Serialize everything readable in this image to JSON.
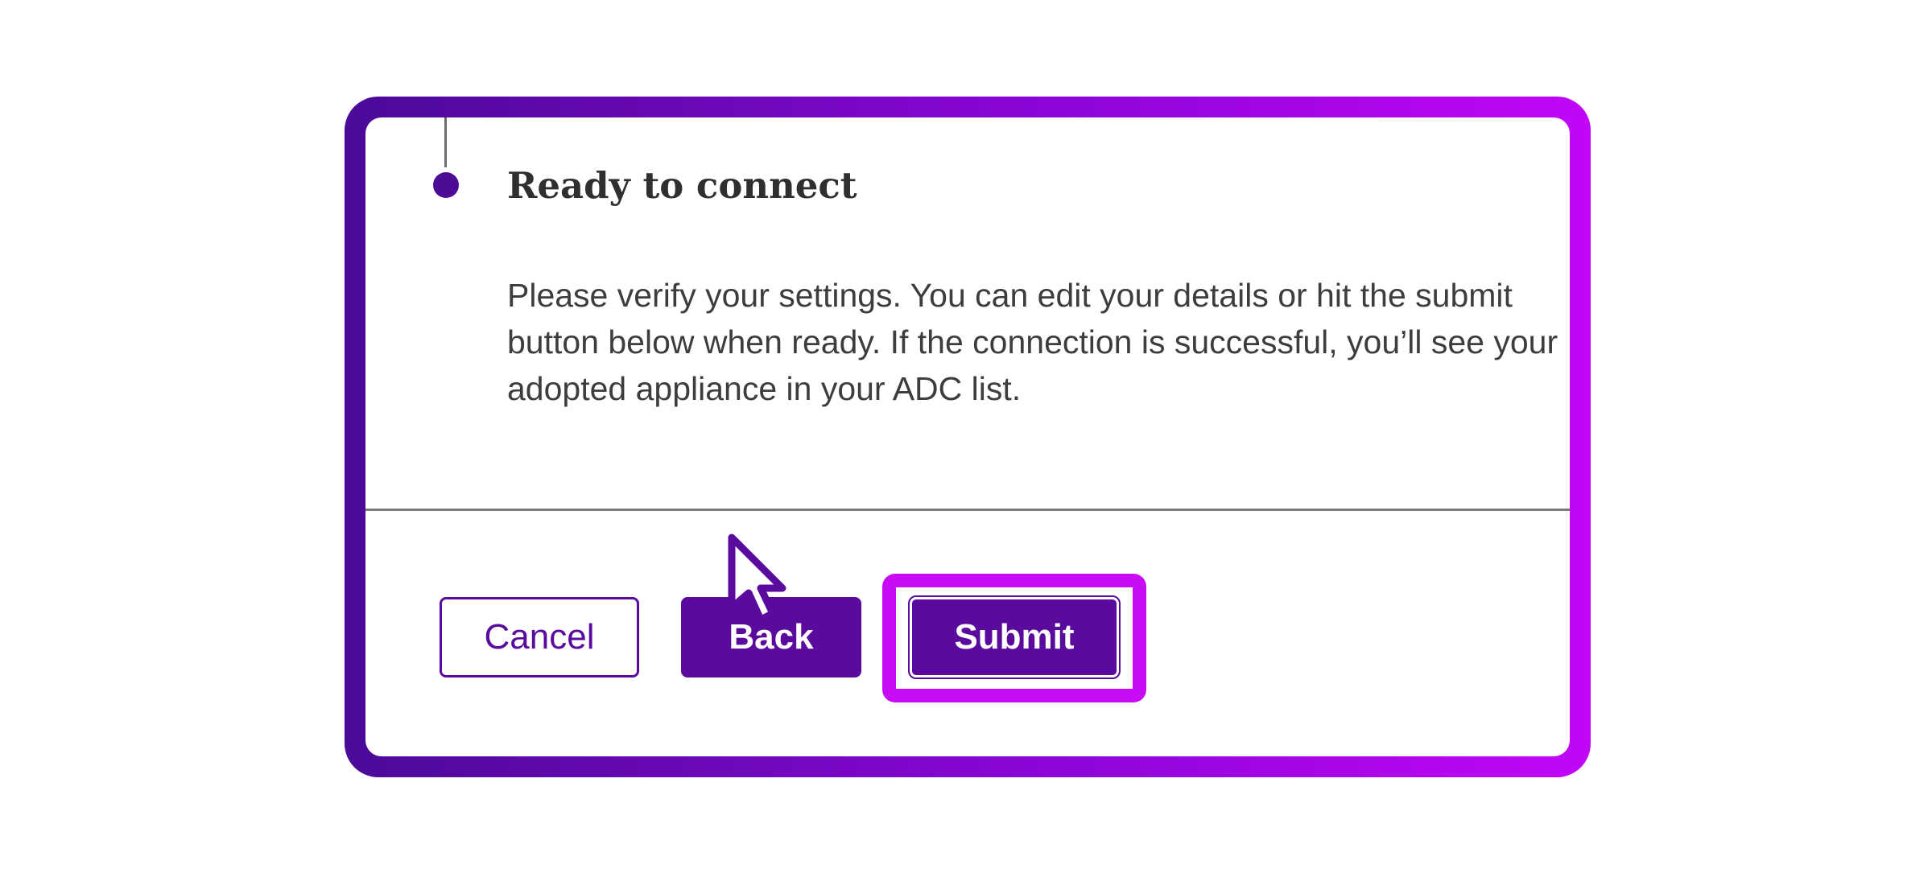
{
  "step": {
    "title": "Ready to connect",
    "description": "Please verify your settings. You can edit your details or hit the submit button below when ready. If the connection is successful, you’ll see your adopted appliance in your ADC list."
  },
  "buttons": {
    "cancel_label": "Cancel",
    "back_label": "Back",
    "submit_label": "Submit"
  },
  "colors": {
    "primary": "#5a0b9e",
    "highlight": "#c70cf5",
    "frame_gradient_start": "#4b0a98",
    "frame_gradient_end": "#c206f8"
  },
  "icons": {
    "cursor": "mouse-pointer-icon",
    "step_marker": "step-dot-icon"
  }
}
